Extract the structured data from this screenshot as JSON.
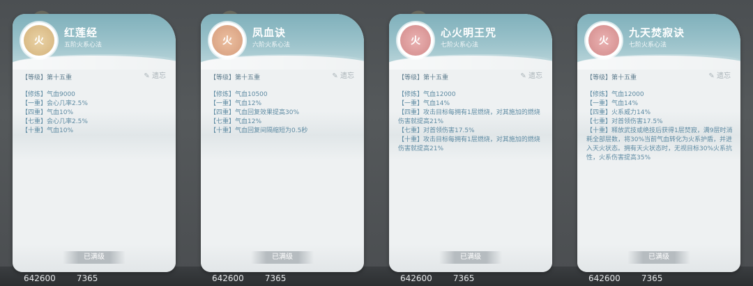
{
  "background": {
    "stats": [
      {
        "power": "642600",
        "other": "7365"
      },
      {
        "power": "642600",
        "other": "7365"
      },
      {
        "power": "642600",
        "other": "7365"
      },
      {
        "power": "642600",
        "other": "7365"
      }
    ]
  },
  "cards": [
    {
      "name": "红莲经",
      "rank": "五阶火系心法",
      "emblem_char": "火",
      "level_label": "【等级】",
      "level_value": "第十五重",
      "forget_label": "遗忘",
      "lines": [
        "【修炼】气血9000",
        "【一重】会心几率2.5%",
        "【四重】气血10%",
        "【七重】会心几率2.5%",
        "【十重】气血10%"
      ],
      "button": "已满级"
    },
    {
      "name": "凤血诀",
      "rank": "六阶火系心法",
      "emblem_char": "火",
      "level_label": "【等级】",
      "level_value": "第十五重",
      "forget_label": "遗忘",
      "lines": [
        "【修炼】气血10500",
        "【一重】气血12%",
        "【四重】气血回复效果提高30%",
        "【七重】气血12%",
        "【十重】气血回复间隔缩短为0.5秒"
      ],
      "button": "已满级"
    },
    {
      "name": "心火明王咒",
      "rank": "七阶火系心法",
      "emblem_char": "火",
      "level_label": "【等级】",
      "level_value": "第十五重",
      "forget_label": "遗忘",
      "lines": [
        "【修炼】气血12000",
        "【一重】气血14%",
        "【四重】攻击目标每拥有1层燃烧，对其施加的燃烧伤害就提高21%",
        "【七重】对首领伤害17.5%",
        "【十重】攻击目标每拥有1层燃烧，对其施加的燃烧伤害就提高21%"
      ],
      "button": "已满级"
    },
    {
      "name": "九天焚寂诀",
      "rank": "七阶火系心法",
      "emblem_char": "火",
      "level_label": "【等级】",
      "level_value": "第十五重",
      "forget_label": "遗忘",
      "lines": [
        "【修炼】气血12000",
        "【一重】气血14%",
        "【四重】火系威力14%",
        "【七重】对首领伤害17.5%",
        "【十重】释放武技或绝技后获得1层焚寂，满9层时消耗全部层数，将30%当前气血转化为火系护盾，并进入天火状态。拥有天火状态时，无视目标30%火系抗性，火系伤害提高35%"
      ],
      "button": "已满级"
    }
  ]
}
